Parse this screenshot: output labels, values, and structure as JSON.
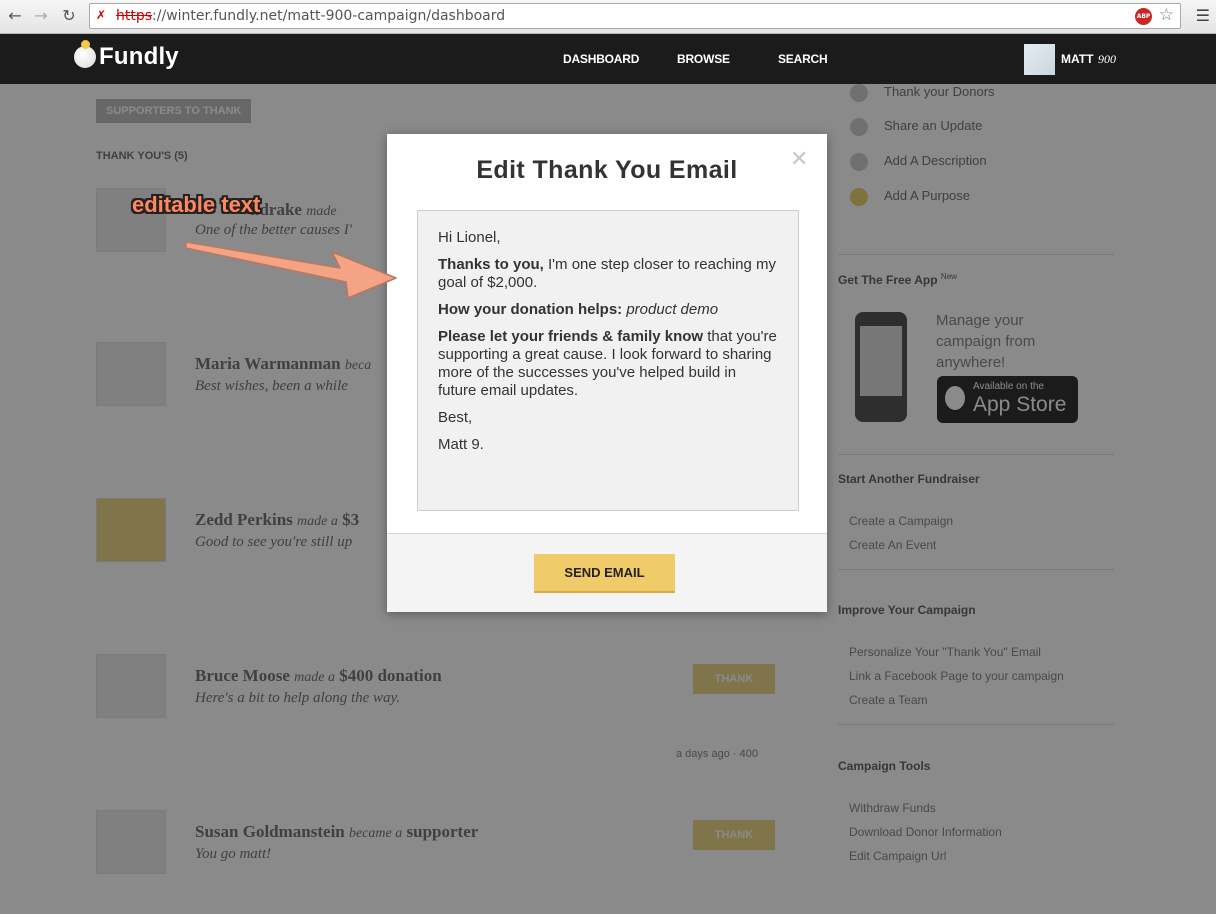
{
  "browser": {
    "url_protocol": "https",
    "url_rest": "://winter.fundly.net/matt-900-campaign/dashboard",
    "abp_label": "ABP"
  },
  "header": {
    "logo_text": "Fundly",
    "nav": [
      "DASHBOARD",
      "BROWSE",
      "SEARCH"
    ],
    "user_name": "MATT",
    "user_number": "900"
  },
  "background": {
    "supporters_button": "SUPPORTERS TO THANK",
    "thank_yous_heading": "THANK YOU'S (5)",
    "donors": [
      {
        "name": "ndrake",
        "action": "made",
        "amount": "",
        "message": "One of the better causes I'"
      },
      {
        "name": "Maria Warmanman",
        "action": "beca",
        "amount": "",
        "message": "Best wishes, been a while"
      },
      {
        "name": "Zedd Perkins",
        "action": "made a",
        "amount": "$3",
        "message": "Good to see you're still up"
      },
      {
        "name": "Bruce Moose",
        "action": "made a",
        "amount": "$400 donation",
        "message": "Here's a bit to help along the way."
      },
      {
        "name": "Susan Goldmanstein",
        "action": "became a",
        "amount": "supporter",
        "message": "You go matt!"
      }
    ],
    "thank_label": "THANK",
    "meta_text": "a days ago · 400",
    "steps": [
      {
        "label": "Thank your Donors",
        "done": false
      },
      {
        "label": "Share an Update",
        "done": false
      },
      {
        "label": "Add A Description",
        "done": false
      },
      {
        "label": "Add A Purpose",
        "done": true
      }
    ],
    "app_heading": "Get The Free App",
    "app_new": "New",
    "app_text": "Manage your campaign from anywhere!",
    "appstore_small": "Available on the",
    "appstore_big": "App Store",
    "start_heading": "Start Another Fundraiser",
    "start_links": [
      "Create a Campaign",
      "Create An Event"
    ],
    "improve_heading": "Improve Your Campaign",
    "improve_links": [
      "Personalize Your \"Thank You\" Email",
      "Link a Facebook Page to your campaign",
      "Create a Team"
    ],
    "tools_heading": "Campaign Tools",
    "tools_links": [
      "Withdraw Funds",
      "Download Donor Information",
      "Edit Campaign Url"
    ]
  },
  "modal": {
    "title": "Edit Thank You Email",
    "greeting": "Hi Lionel,",
    "p1_bold": "Thanks to you,",
    "p1_text": " I'm one step closer to reaching my goal of $2,000.",
    "p2_bold": "How your donation helps:",
    "p2_italic": " product demo",
    "p3_bold": "Please let your friends & family know",
    "p3_text": " that you're supporting a great cause. I look forward to sharing more of the successes you've helped build in future email updates.",
    "signoff": "Best,",
    "signature": "Matt 9.",
    "send_button": "SEND EMAIL"
  },
  "annotation": {
    "label": "editable text"
  }
}
